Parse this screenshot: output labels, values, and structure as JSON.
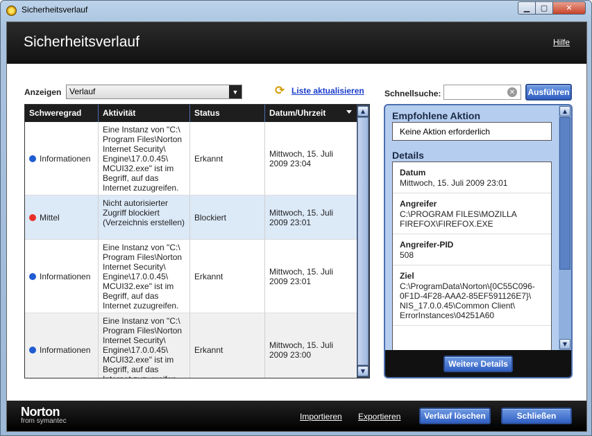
{
  "window": {
    "title": "Sicherheitsverlauf"
  },
  "header": {
    "title": "Sicherheitsverlauf",
    "help": "Hilfe"
  },
  "filter": {
    "label": "Anzeigen",
    "selected": "Verlauf",
    "refresh": "Liste aktualisieren"
  },
  "table": {
    "columns": [
      "Schweregrad",
      "Aktivität",
      "Status",
      "Datum/Uhrzeit"
    ],
    "rows": [
      {
        "severity": "Informationen",
        "severity_color": "#1f5bd1",
        "activity": "Eine Instanz von \"C:\\ Program Files\\Norton Internet Security\\ Engine\\17.0.0.45\\ MCUI32.exe\" ist im Begriff, auf das Internet zuzugreifen.",
        "status": "Erkannt",
        "date": "Mittwoch, 15. Juli 2009 23:04"
      },
      {
        "severity": "Mittel",
        "severity_color": "#e8302a",
        "activity": "Nicht autorisierter Zugriff blockiert (Verzeichnis erstellen)",
        "status": "Blockiert",
        "date": "Mittwoch, 15. Juli 2009 23:01"
      },
      {
        "severity": "Informationen",
        "severity_color": "#1f5bd1",
        "activity": "Eine Instanz von \"C:\\ Program Files\\Norton Internet Security\\ Engine\\17.0.0.45\\ MCUI32.exe\" ist im Begriff, auf das Internet zuzugreifen.",
        "status": "Erkannt",
        "date": "Mittwoch, 15. Juli 2009 23:01"
      },
      {
        "severity": "Informationen",
        "severity_color": "#1f5bd1",
        "activity": "Eine Instanz von \"C:\\ Program Files\\Norton Internet Security\\ Engine\\17.0.0.45\\ MCUI32.exe\" ist im Begriff, auf das Internet zuzugreifen.",
        "status": "Erkannt",
        "date": "Mittwoch, 15. Juli 2009 23:00"
      }
    ]
  },
  "search": {
    "label": "Schnellsuche:",
    "value": "",
    "button": "Ausführen"
  },
  "panel": {
    "recommended_title": "Empfohlene Aktion",
    "recommended_value": "Keine Aktion erforderlich",
    "details_title": "Details",
    "details": [
      {
        "title": "Datum",
        "value": "Mittwoch, 15. Juli 2009 23:01"
      },
      {
        "title": "Angreifer",
        "value": "C:\\PROGRAM FILES\\MOZILLA FIREFOX\\FIREFOX.EXE"
      },
      {
        "title": "Angreifer-PID",
        "value": "508"
      },
      {
        "title": "Ziel",
        "value": "C:\\ProgramData\\Norton\\{0C55C096-0F1D-4F28-AAA2-85EF591126E7}\\ NIS_17.0.0.45\\Common Client\\ ErrorInstances\\04251A60"
      }
    ],
    "more_button": "Weitere Details"
  },
  "footer": {
    "logo": "Norton",
    "logo_sub": "from symantec",
    "import": "Importieren",
    "export": "Exportieren",
    "clear": "Verlauf löschen",
    "close": "Schließen"
  }
}
